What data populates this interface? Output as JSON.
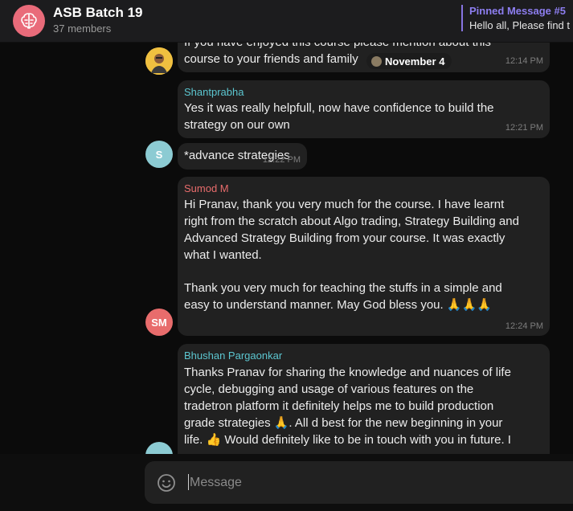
{
  "header": {
    "title": "ASB Batch 19",
    "subtitle": "37 members",
    "pinned_title": "Pinned Message #5",
    "pinned_text": "Hello all, Please find t"
  },
  "date_chip": "November 4",
  "messages": [
    {
      "lines": [
        "If you have enjoyed this course please mention about this",
        "course to your friends and family"
      ],
      "time": "12:14 PM"
    },
    {
      "sender": "Shantprabha",
      "lines": [
        "Yes it was really helpfull, now have confidence to build the",
        "strategy on our own"
      ],
      "time": "12:21 PM"
    },
    {
      "avatar_initials": "S",
      "lines": [
        "*advance strategies"
      ],
      "time": "12:22 PM"
    },
    {
      "sender": "Sumod M",
      "avatar_initials": "SM",
      "lines": [
        "Hi Pranav, thank you very much for the course. I have learnt",
        "right from the scratch about Algo trading, Strategy Building and",
        "Advanced Strategy Building from your course. It was exactly",
        "what I wanted.",
        "",
        "Thank you very much for teaching the stuffs in a simple and",
        "easy to understand manner. May God bless you. 🙏🙏🙏"
      ],
      "time": "12:24 PM"
    },
    {
      "sender": "Bhushan Pargaonkar",
      "lines": [
        "Thanks Pranav for sharing the knowledge and nuances of life",
        "cycle, debugging and usage of various features on the",
        "tradetron platform it definitely helps me to build production",
        "grade strategies 🙏. All d best for the new beginning in your",
        "life. 👍 Would definitely like to be in touch with you in future. I"
      ]
    }
  ],
  "composer": {
    "placeholder": "Message"
  },
  "colors": {
    "accent": "#8774e1",
    "sender_cyan": "#5cc6d0",
    "sender_red": "#e86c6c",
    "avatar_s": "#8ccbd3",
    "avatar_sm": "#e86c6c",
    "group_avatar": "#e96b7a"
  },
  "icons": [
    "brain-icon",
    "emoji-icon"
  ]
}
